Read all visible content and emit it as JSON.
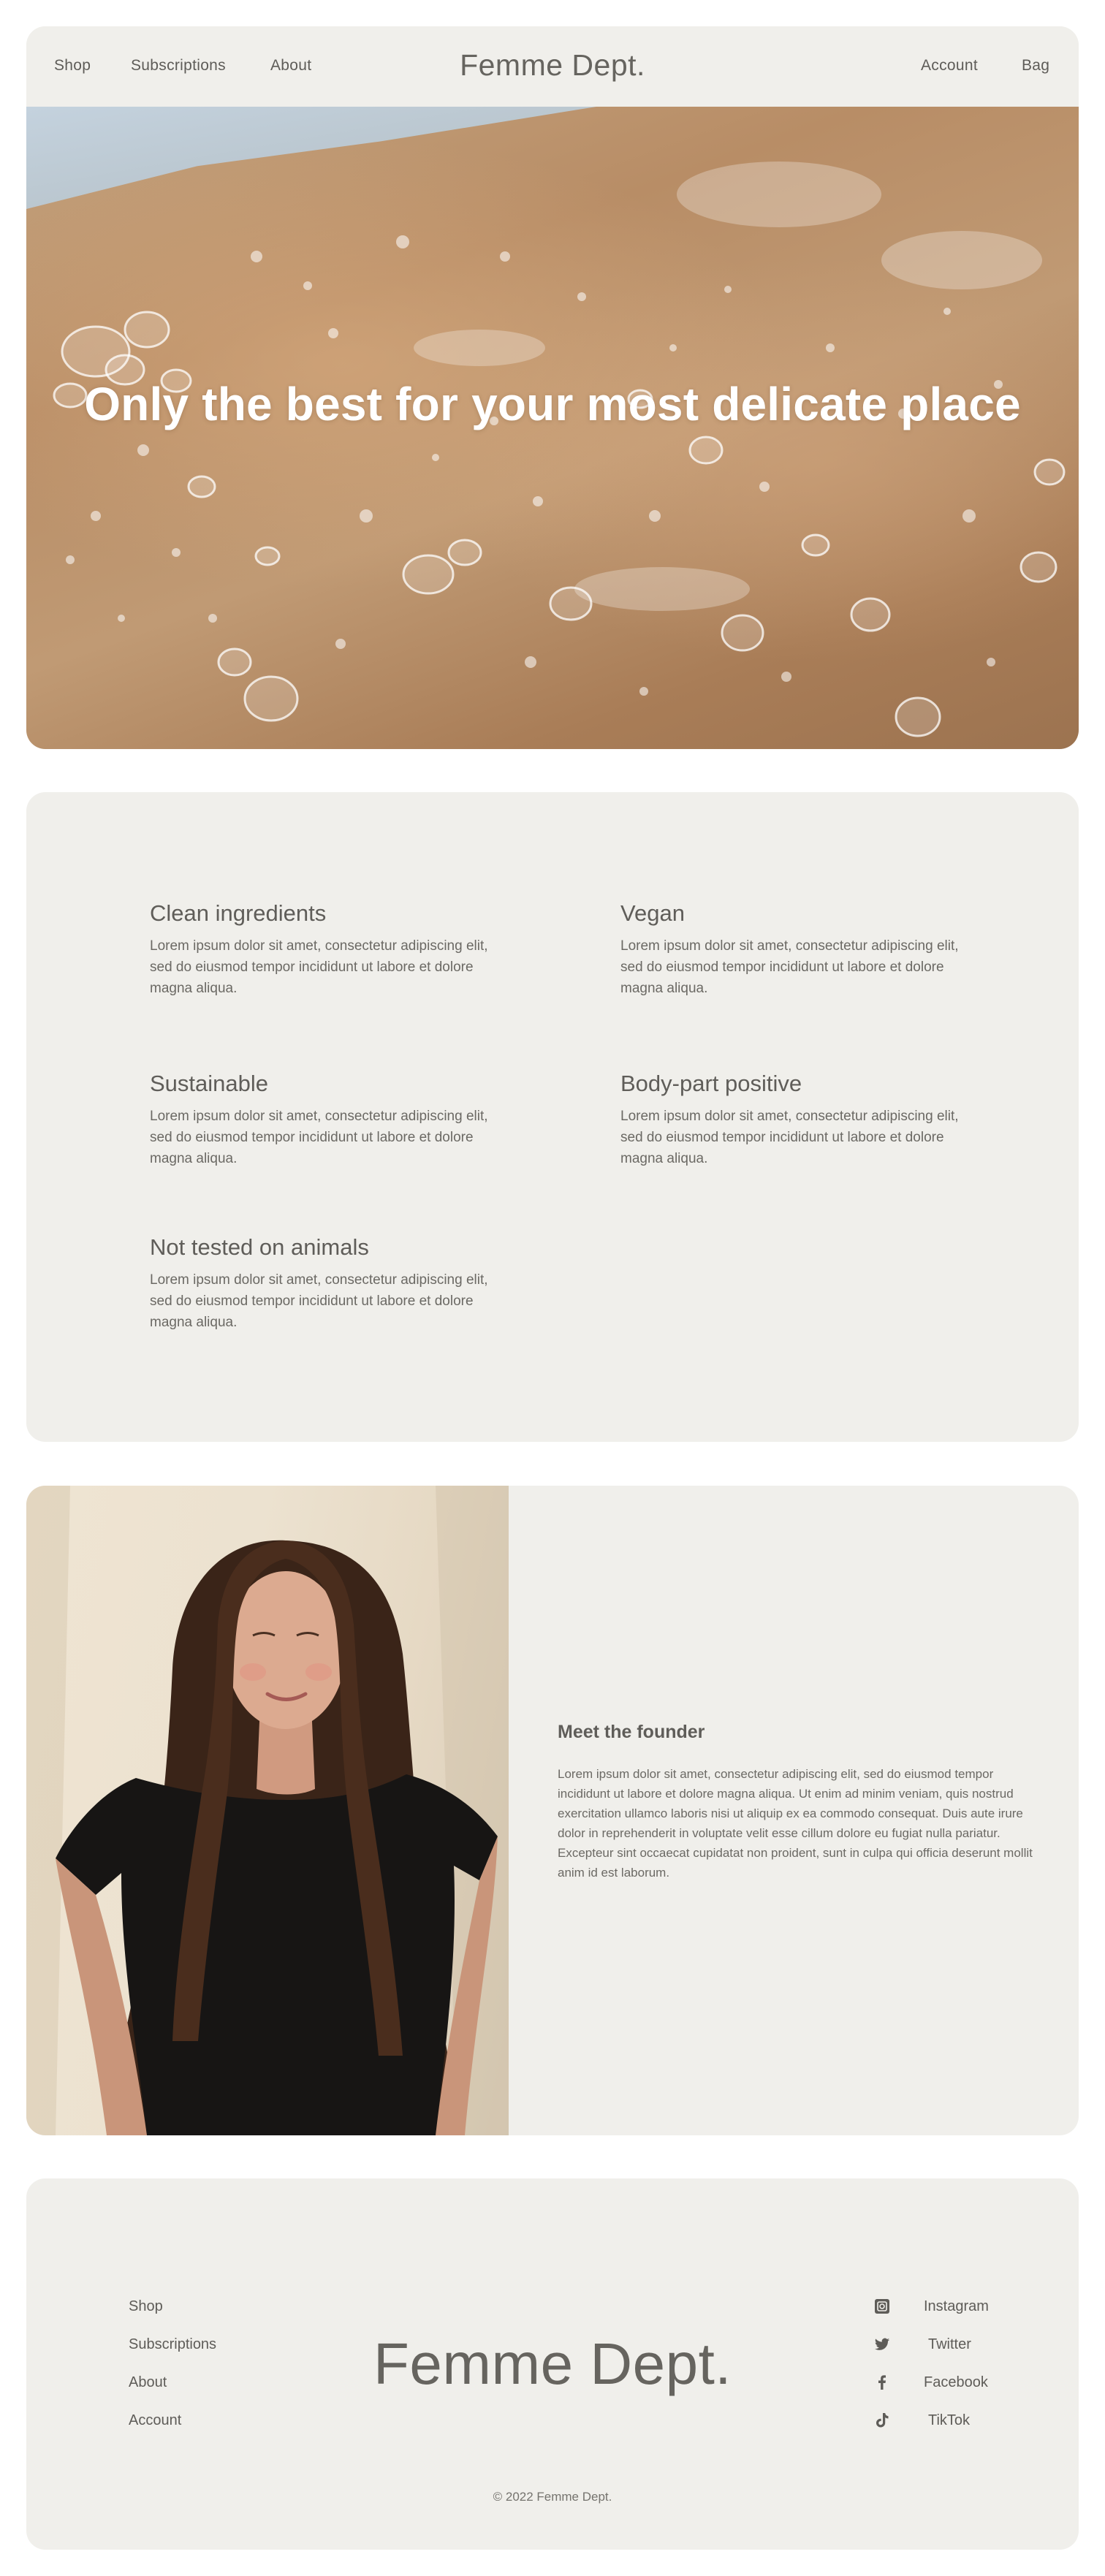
{
  "header": {
    "nav_left": [
      "Shop",
      "Subscriptions",
      "About"
    ],
    "brand": "Femme Dept.",
    "nav_right": [
      "Account",
      "Bag"
    ]
  },
  "hero": {
    "title": "Only the best for your most delicate place"
  },
  "values": [
    {
      "title": "Clean ingredients",
      "text": "Lorem ipsum dolor sit amet, consectetur adipiscing elit, sed do eiusmod tempor incididunt ut labore et dolore magna aliqua."
    },
    {
      "title": "Vegan",
      "text": "Lorem ipsum dolor sit amet, consectetur adipiscing elit, sed do eiusmod tempor incididunt ut labore et dolore magna aliqua."
    },
    {
      "title": "Sustainable",
      "text": "Lorem ipsum dolor sit amet, consectetur adipiscing elit, sed do eiusmod tempor incididunt ut labore et dolore magna aliqua."
    },
    {
      "title": "Body-part positive",
      "text": "Lorem ipsum dolor sit amet, consectetur adipiscing elit, sed do eiusmod tempor incididunt ut labore et dolore magna aliqua."
    },
    {
      "title": "Not tested on animals",
      "text": "Lorem ipsum dolor sit amet, consectetur adipiscing elit, sed do eiusmod tempor incididunt ut labore et dolore magna aliqua."
    }
  ],
  "founder": {
    "title": "Meet the founder",
    "text": "Lorem ipsum dolor sit amet, consectetur adipiscing elit, sed do eiusmod tempor incididunt ut labore et dolore magna aliqua. Ut enim ad minim veniam, quis nostrud exercitation ullamco laboris nisi ut aliquip ex ea commodo consequat. Duis aute irure dolor in reprehenderit in voluptate velit esse cillum dolore eu fugiat nulla pariatur. Excepteur sint occaecat cupidatat non proident, sunt in culpa qui officia deserunt mollit anim id est laborum."
  },
  "footer": {
    "links": [
      "Shop",
      "Subscriptions",
      "About",
      "Account"
    ],
    "brand": "Femme Dept.",
    "social": [
      {
        "label": "Instagram",
        "icon": "instagram-icon"
      },
      {
        "label": "Twitter",
        "icon": "twitter-icon"
      },
      {
        "label": "Facebook",
        "icon": "facebook-icon"
      },
      {
        "label": "TikTok",
        "icon": "tiktok-icon"
      }
    ],
    "copyright": "© 2022 Femme Dept."
  },
  "colors": {
    "page_background": "#ffffff",
    "card_background": "#f0efeb",
    "text": "#66645f",
    "hero_text": "#ffffff"
  }
}
